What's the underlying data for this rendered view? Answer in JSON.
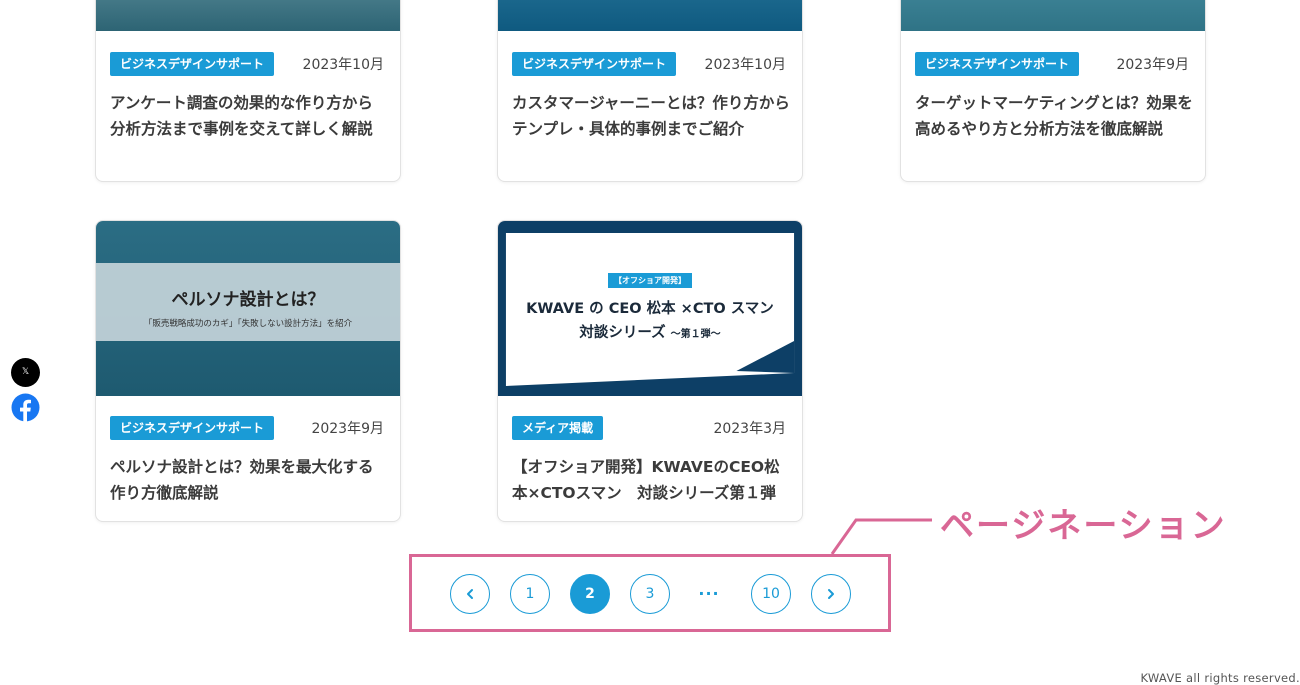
{
  "articles": [
    {
      "category": "ビジネスデザインサポート",
      "date": "2023年10月",
      "title": "アンケート調査の効果的な作り方から分析方法まで事例を交えて詳しく解説"
    },
    {
      "category": "ビジネスデザインサポート",
      "date": "2023年10月",
      "title": "カスタマージャーニーとは？作り方からテンプレ・具体的事例までご紹介"
    },
    {
      "category": "ビジネスデザインサポート",
      "date": "2023年9月",
      "title": "ターゲットマーケティングとは？効果を高めるやり方と分析方法を徹底解説"
    },
    {
      "category": "ビジネスデザインサポート",
      "date": "2023年9月",
      "title": "ペルソナ設計とは？効果を最大化する作り方徹底解説",
      "thumb_title": "ペルソナ設計とは？",
      "thumb_sub": "「販売戦略成功のカギ」「失敗しない設計方法」を紹介"
    },
    {
      "category": "メディア掲載",
      "date": "2023年3月",
      "title": "【オフショア開発】KWAVEのCEO松本×CTOスマン　対談シリーズ第１弾",
      "thumb_tag": "【オフショア開発】",
      "thumb_line1": "KWAVE の CEO 松本 ×CTO スマン",
      "thumb_line2": "対談シリーズ",
      "thumb_line2_small": "～第１弾～"
    }
  ],
  "social": {
    "x_label": "𝕏"
  },
  "pagination": {
    "prev_icon": "chevron-left-icon",
    "next_icon": "chevron-right-icon",
    "prev": "<",
    "next": ">",
    "pages": [
      "1",
      "2",
      "3",
      "10"
    ],
    "current": "2",
    "ellipsis": "..."
  },
  "annotation": "ページネーション",
  "footer": "KWAVE all rights reserved.",
  "colors": {
    "accent": "#1a9bd6",
    "annotation": "#d96795"
  }
}
